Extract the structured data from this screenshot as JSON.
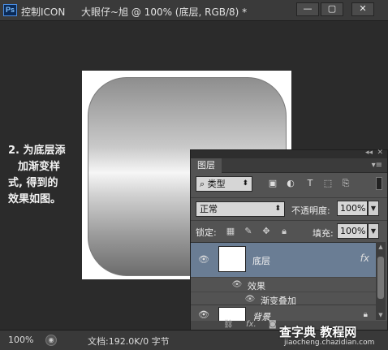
{
  "titlebar": {
    "logo": "Ps",
    "app_title": "控制ICON",
    "doc_title": "大眼仔~旭 @ 100% (底层, RGB/8) *",
    "minimize": "—",
    "restore": "▢",
    "close": "✕"
  },
  "note": {
    "lines": [
      "2. 为底层添",
      "加渐变样",
      "式, 得到的",
      "效果如图。"
    ]
  },
  "status": {
    "zoom": "100%",
    "doc_info": "文档:192.0K/0 字节"
  },
  "layers_panel": {
    "tab": "图层",
    "filter_kind": "类型",
    "blend_mode": "正常",
    "opacity_label": "不透明度:",
    "opacity_value": "100%",
    "lock_label": "锁定:",
    "fill_label": "填充:",
    "fill_value": "100%",
    "layers": [
      {
        "name": "底层",
        "fx": "fx",
        "effects_label": "效果",
        "effect": "渐变叠加",
        "selected": true
      },
      {
        "name": "背景",
        "locked": true
      }
    ]
  },
  "watermark": {
    "text": "查字典 教程网",
    "url": "jiaocheng.chazidian.com"
  },
  "colors": {
    "selected_layer": "#6a7d94",
    "panel_bg": "#535353",
    "workspace": "#2b2b2b"
  }
}
